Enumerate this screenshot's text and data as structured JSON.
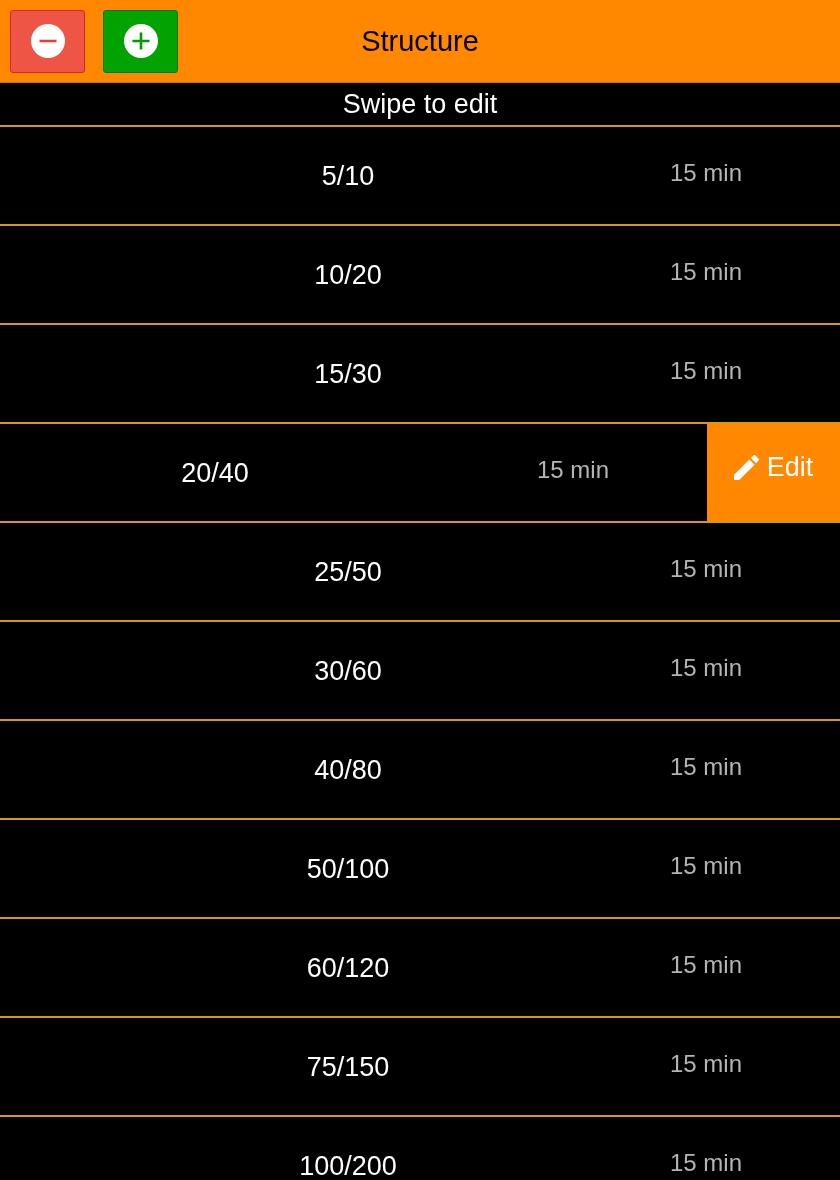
{
  "header": {
    "title": "Structure",
    "buttons": [
      {
        "kind": "remove"
      },
      {
        "kind": "add"
      }
    ]
  },
  "hint": "Swipe to edit",
  "swipe_action": {
    "label": "Edit"
  },
  "rows": [
    {
      "blinds": "5/10",
      "duration": "15 min",
      "swiped": false
    },
    {
      "blinds": "10/20",
      "duration": "15 min",
      "swiped": false
    },
    {
      "blinds": "15/30",
      "duration": "15 min",
      "swiped": false
    },
    {
      "blinds": "20/40",
      "duration": "15 min",
      "swiped": true
    },
    {
      "blinds": "25/50",
      "duration": "15 min",
      "swiped": false
    },
    {
      "blinds": "30/60",
      "duration": "15 min",
      "swiped": false
    },
    {
      "blinds": "40/80",
      "duration": "15 min",
      "swiped": false
    },
    {
      "blinds": "50/100",
      "duration": "15 min",
      "swiped": false
    },
    {
      "blinds": "60/120",
      "duration": "15 min",
      "swiped": false
    },
    {
      "blinds": "75/150",
      "duration": "15 min",
      "swiped": false
    },
    {
      "blinds": "100/200",
      "duration": "15 min",
      "swiped": false
    }
  ]
}
